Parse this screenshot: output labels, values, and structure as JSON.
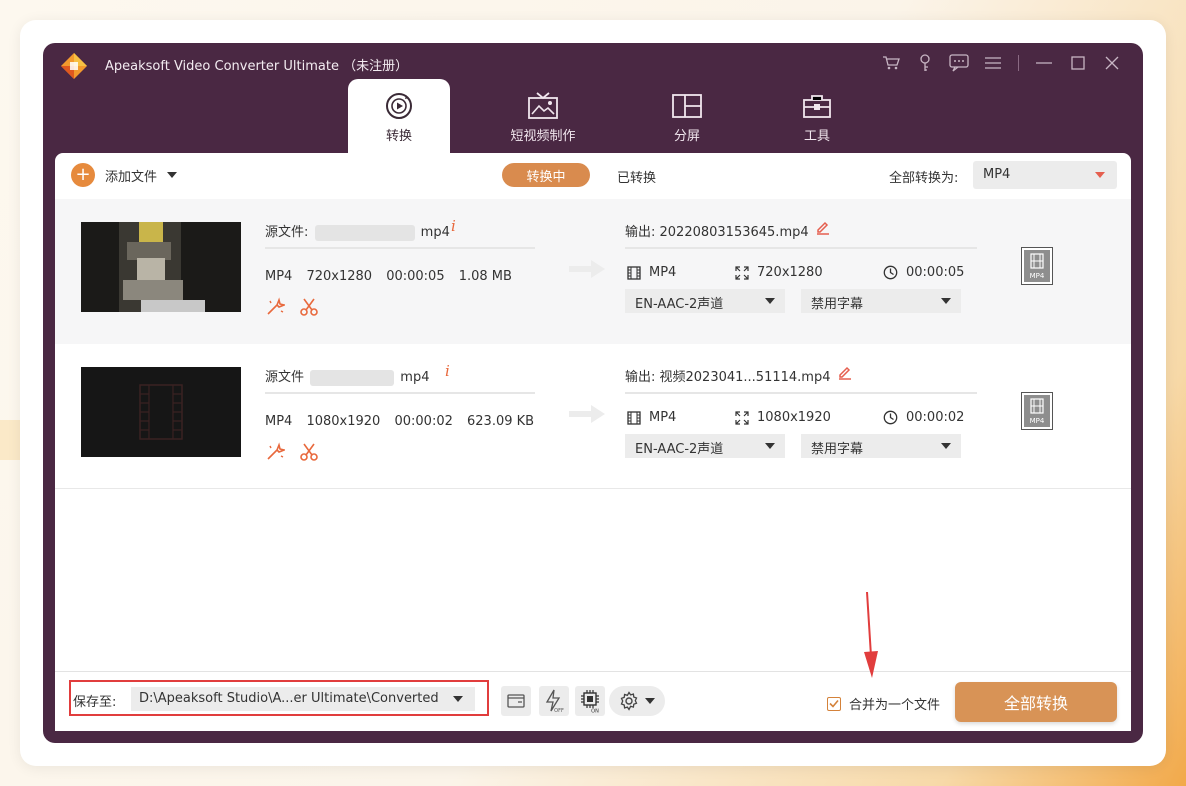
{
  "app": {
    "title": "Apeaksoft Video Converter Ultimate （未注册）"
  },
  "tabs": [
    {
      "label": "转换",
      "icon": "convert-icon",
      "active": true
    },
    {
      "label": "短视频制作",
      "icon": "mv-icon",
      "active": false
    },
    {
      "label": "分屏",
      "icon": "collage-icon",
      "active": false
    },
    {
      "label": "工具",
      "icon": "toolbox-icon",
      "active": false
    }
  ],
  "toolbar": {
    "add_file_label": "添加文件",
    "segment_converting": "转换中",
    "segment_converted": "已转换",
    "convert_all_to_label": "全部转换为:",
    "convert_all_format": "MP4"
  },
  "files": [
    {
      "source_prefix": "源文件:",
      "source_suffix": "mp4",
      "meta": {
        "format": "MP4",
        "resolution": "720x1280",
        "duration": "00:00:05",
        "size": "1.08 MB"
      },
      "output_label": "输出: 20220803153645.mp4",
      "out_format": "MP4",
      "out_resolution": "720x1280",
      "out_duration": "00:00:05",
      "audio_track": "EN-AAC-2声道",
      "subtitle": "禁用字幕",
      "badge": "MP4"
    },
    {
      "source_prefix": "源文件",
      "source_suffix": "mp4",
      "meta": {
        "format": "MP4",
        "resolution": "1080x1920",
        "duration": "00:00:02",
        "size": "623.09 KB"
      },
      "output_label": "输出: 视频2023041...51114.mp4",
      "out_format": "MP4",
      "out_resolution": "1080x1920",
      "out_duration": "00:00:02",
      "audio_track": "EN-AAC-2声道",
      "subtitle": "禁用字幕",
      "badge": "MP4"
    }
  ],
  "bottom": {
    "save_to_label": "保存至:",
    "save_path": "D:\\Apeaksoft Studio\\A...er Ultimate\\Converted",
    "merge_label": "合并为一个文件",
    "merge_checked": true,
    "convert_all_button": "全部转换"
  },
  "colors": {
    "window_bg": "#4a2843",
    "accent": "#d98b4e",
    "annotation": "#e13d3d"
  }
}
